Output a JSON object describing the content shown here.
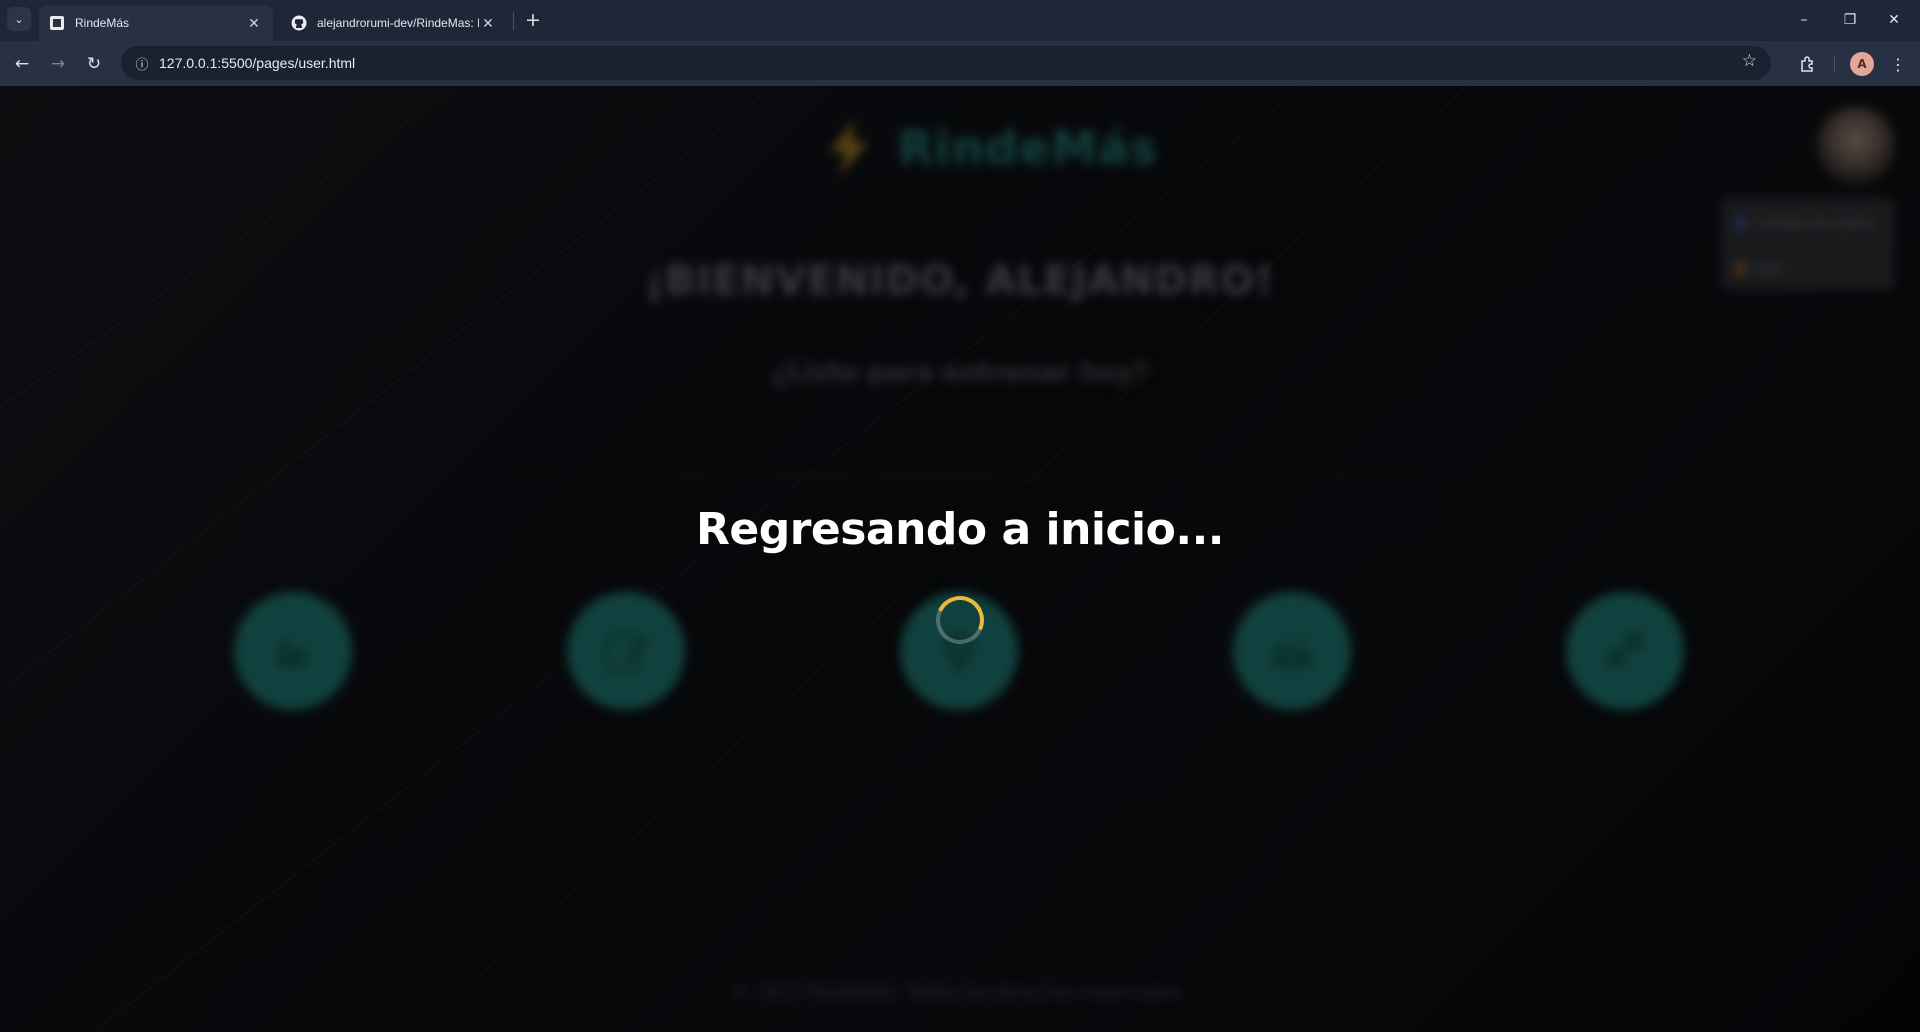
{
  "browser": {
    "tabs": [
      {
        "title": "RindeMás",
        "active": true,
        "close": "✕"
      },
      {
        "title": "alejandrorumi-dev/RindeMas: F",
        "active": false,
        "close": "✕"
      }
    ],
    "new_tab": "+",
    "url": "127.0.0.1:5500/pages/user.html",
    "window_controls": {
      "minimize": "–",
      "restore": "❐",
      "close": "✕"
    },
    "profile_initial": "A"
  },
  "page": {
    "brand": "RindeMás",
    "welcome": "¡BIENVENIDO, ALEJANDRO!",
    "subtitle": "¿Listo para entrenar hoy?",
    "features": [
      {
        "icon": "bicep-icon"
      },
      {
        "icon": "edit-icon"
      },
      {
        "icon": "location-pin-icon"
      },
      {
        "icon": "chart-icon"
      },
      {
        "icon": "shapes-icon"
      }
    ],
    "user_menu": [
      "Cambiar de usuario",
      "Salir"
    ],
    "footer": "© 2025 RindeMás. Todos los derechos reservados."
  },
  "overlay": {
    "loading_text": "Regresando a inicio..."
  },
  "colors": {
    "brand_teal": "#1c6964",
    "accent_yellow": "#e8b93a",
    "chrome_bg": "#1e2638"
  }
}
